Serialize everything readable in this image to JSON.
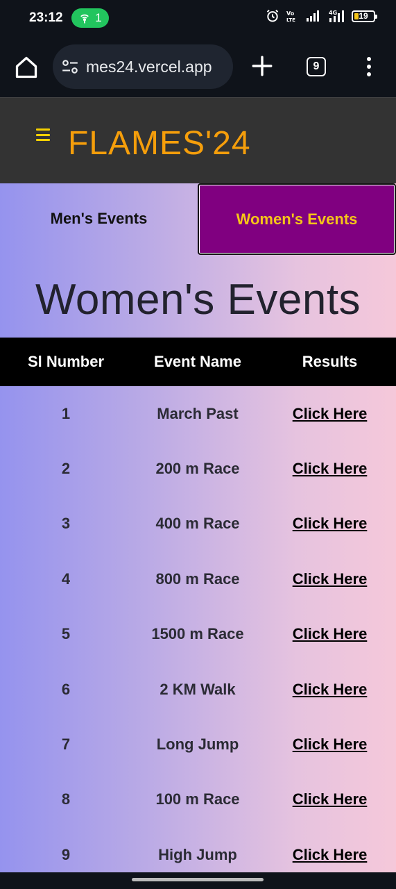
{
  "status_bar": {
    "time": "23:12",
    "hotspot_count": "1",
    "battery_level": "19",
    "network_label": "4G"
  },
  "browser": {
    "url": "mes24.vercel.app",
    "tab_count": "9"
  },
  "site": {
    "brand": "FLAMES'24"
  },
  "tabs": {
    "men_label": "Men's Events",
    "women_label": "Women's Events"
  },
  "page": {
    "heading": "Women's Events"
  },
  "table": {
    "headers": [
      "Sl Number",
      "Event Name",
      "Results"
    ],
    "rows": [
      {
        "num": "1",
        "event": "March Past",
        "link": "Click Here"
      },
      {
        "num": "2",
        "event": "200 m Race",
        "link": "Click Here"
      },
      {
        "num": "3",
        "event": "400 m Race",
        "link": "Click Here"
      },
      {
        "num": "4",
        "event": "800 m Race",
        "link": "Click Here"
      },
      {
        "num": "5",
        "event": "1500 m Race",
        "link": "Click Here"
      },
      {
        "num": "6",
        "event": "2 KM Walk",
        "link": "Click Here"
      },
      {
        "num": "7",
        "event": "Long Jump",
        "link": "Click Here"
      },
      {
        "num": "8",
        "event": "100 m Race",
        "link": "Click Here"
      },
      {
        "num": "9",
        "event": "High Jump",
        "link": "Click Here"
      }
    ]
  },
  "colors": {
    "brand": "#f59e0b",
    "active_tab_bg": "#800080",
    "active_tab_text": "#f5c518",
    "header_bg": "#333333"
  }
}
